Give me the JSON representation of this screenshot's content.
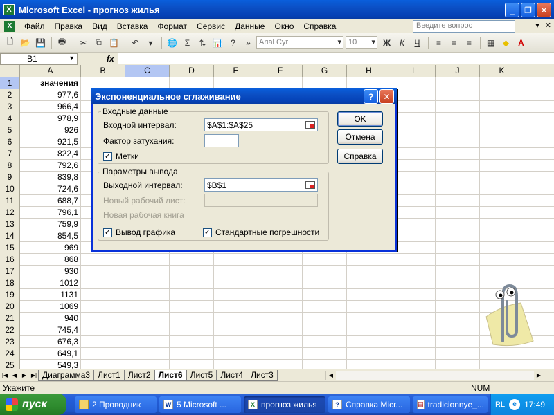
{
  "window": {
    "title": "Microsoft Excel - прогноз жилья"
  },
  "menu": [
    "Файл",
    "Правка",
    "Вид",
    "Вставка",
    "Формат",
    "Сервис",
    "Данные",
    "Окно",
    "Справка"
  ],
  "help_search": {
    "placeholder": "Введите вопрос"
  },
  "toolbar": {
    "font_name": "Arial Cyr",
    "font_size": "10"
  },
  "formula_bar": {
    "name_box": "B1",
    "fx": "fx",
    "value": ""
  },
  "columns": [
    "A",
    "B",
    "C",
    "D",
    "E",
    "F",
    "G",
    "H",
    "I",
    "J",
    "K"
  ],
  "rows": [
    {
      "n": "1",
      "a": "значения"
    },
    {
      "n": "2",
      "a": "977,6"
    },
    {
      "n": "3",
      "a": "966,4"
    },
    {
      "n": "4",
      "a": "978,9"
    },
    {
      "n": "5",
      "a": "926"
    },
    {
      "n": "6",
      "a": "921,5"
    },
    {
      "n": "7",
      "a": "822,4"
    },
    {
      "n": "8",
      "a": "792,6"
    },
    {
      "n": "9",
      "a": "839,8"
    },
    {
      "n": "10",
      "a": "724,6"
    },
    {
      "n": "11",
      "a": "688,7"
    },
    {
      "n": "12",
      "a": "796,1"
    },
    {
      "n": "13",
      "a": "759,9"
    },
    {
      "n": "14",
      "a": "854,5"
    },
    {
      "n": "15",
      "a": "969"
    },
    {
      "n": "16",
      "a": "868"
    },
    {
      "n": "17",
      "a": "930"
    },
    {
      "n": "18",
      "a": "1012"
    },
    {
      "n": "19",
      "a": "1131"
    },
    {
      "n": "20",
      "a": "1069"
    },
    {
      "n": "21",
      "a": "940"
    },
    {
      "n": "22",
      "a": "745,4"
    },
    {
      "n": "23",
      "a": "676,3"
    },
    {
      "n": "24",
      "a": "649,1"
    },
    {
      "n": "25",
      "a": "549,3"
    }
  ],
  "sheet_tabs": [
    "Диаграмма3",
    "Лист1",
    "Лист2",
    "Лист6",
    "Лист5",
    "Лист4",
    "Лист3"
  ],
  "active_sheet": "Лист6",
  "status": {
    "text": "Укажите",
    "num": "NUM"
  },
  "dialog": {
    "title": "Экспоненциальное сглаживание",
    "input_group": "Входные данные",
    "input_range_label": "Входной интервал:",
    "input_range_value": "$A$1:$A$25",
    "damping_label": "Фактор затухания:",
    "damping_value": "",
    "labels_checkbox": "Метки",
    "output_group": "Параметры вывода",
    "output_range_label": "Выходной интервал:",
    "output_range_value": "$B$1",
    "new_sheet_label": "Новый рабочий лист:",
    "new_book_label": "Новая рабочая книга",
    "chart_output_checkbox": "Вывод графика",
    "std_errors_checkbox": "Стандартные погрешности",
    "ok": "OK",
    "cancel": "Отмена",
    "help": "Справка"
  },
  "taskbar": {
    "start": "пуск",
    "tasks": [
      "2 Проводник",
      "5 Microsoft ...",
      "прогноз жилья",
      "Справка Micr...",
      "tradicionnye_..."
    ],
    "lang": "RL",
    "clock": "17:49"
  }
}
